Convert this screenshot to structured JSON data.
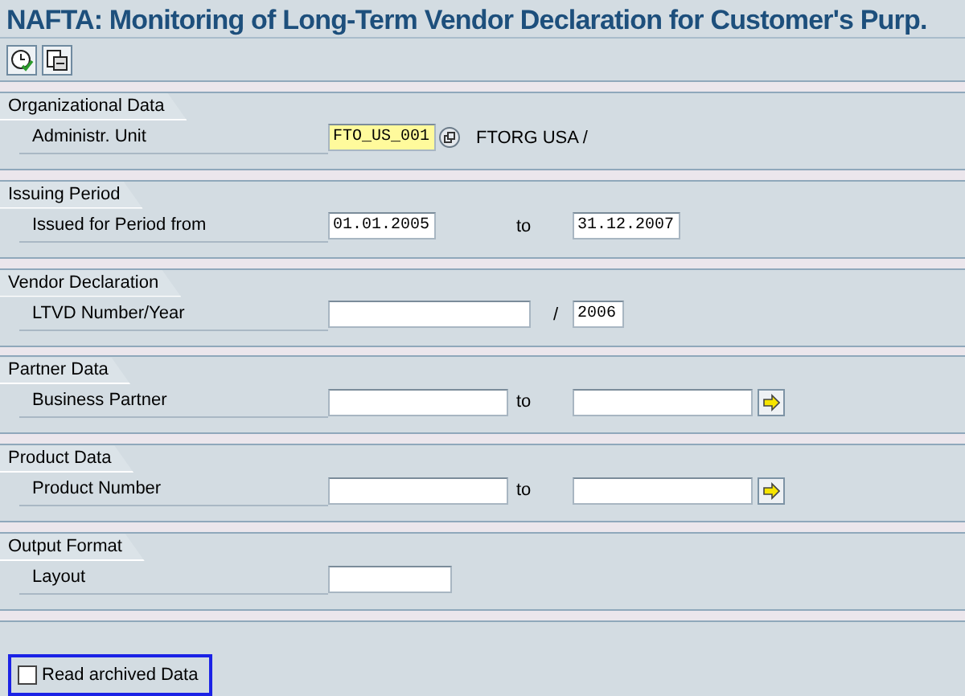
{
  "window": {
    "title": "NAFTA: Monitoring of Long-Term Vendor Declaration for Customer's Purp."
  },
  "toolbar": [
    {
      "kind": "execute"
    },
    {
      "kind": "variants"
    }
  ],
  "sections": [
    {
      "title": "Organizational Data",
      "rows": [
        {
          "label": "Administr. Unit",
          "items": [
            {
              "kind": "code-field",
              "value": "FTO_US_001",
              "description": "FTORG USA /"
            }
          ]
        }
      ]
    },
    {
      "title": "Issuing Period",
      "rows": [
        {
          "label": "Issued for Period from",
          "items": [
            {
              "kind": "short-field",
              "value": "01.01.2005"
            },
            {
              "kind": "to-text",
              "text": "to"
            },
            {
              "kind": "short-field",
              "value": "31.12.2007"
            }
          ]
        }
      ]
    },
    {
      "title": "Vendor Declaration",
      "rows": [
        {
          "label": "LTVD Number/Year",
          "items": [
            {
              "kind": "wide-field"
            },
            {
              "kind": "slash-text",
              "text": "/"
            },
            {
              "kind": "year-field",
              "value": "2006"
            }
          ]
        }
      ]
    },
    {
      "title": "Partner Data",
      "rows": [
        {
          "label": "Business Partner",
          "items": [
            {
              "kind": "long-field"
            },
            {
              "kind": "to-text",
              "text": "to"
            },
            {
              "kind": "long-field"
            },
            {
              "kind": "arrow-button"
            }
          ]
        }
      ]
    },
    {
      "title": "Product Data",
      "rows": [
        {
          "label": "Product Number",
          "items": [
            {
              "kind": "long-field"
            },
            {
              "kind": "to-text",
              "text": "to"
            },
            {
              "kind": "long-field"
            },
            {
              "kind": "arrow-button"
            }
          ]
        }
      ]
    },
    {
      "title": "Output Format",
      "rows": [
        {
          "label": "Layout",
          "items": [
            {
              "kind": "layout-field"
            }
          ]
        }
      ]
    }
  ],
  "archive": {
    "label": "Read archived Data",
    "checked": false
  }
}
